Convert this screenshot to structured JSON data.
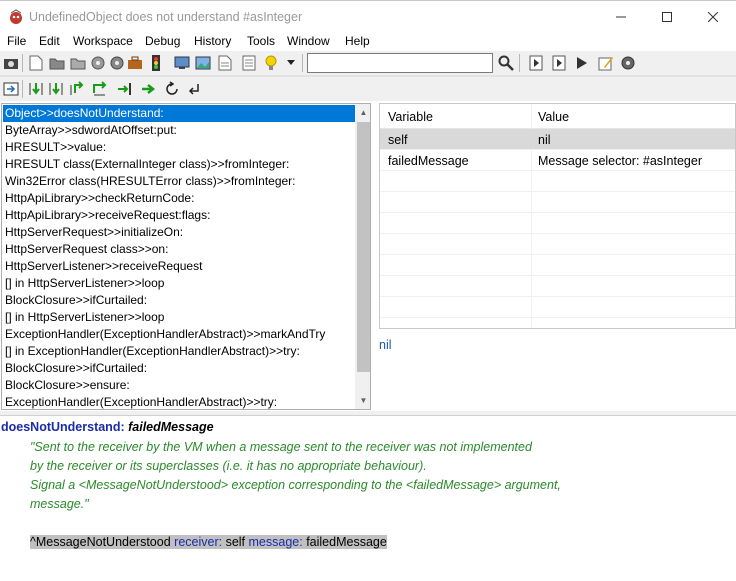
{
  "window": {
    "title": "UndefinedObject does not understand #asInteger",
    "minimize_icon": "minimize-icon",
    "maximize_icon": "maximize-icon",
    "close_icon": "close-icon"
  },
  "menu": {
    "items": [
      "File",
      "Edit",
      "Workspace",
      "Debug",
      "History",
      "Tools",
      "Window",
      "Help"
    ]
  },
  "toolbar": {
    "search": {
      "value": "",
      "placeholder": ""
    },
    "icons_row1": [
      "camera-icon",
      "new-document-icon",
      "open-folder-icon",
      "open-folder-2-icon",
      "gear-icon",
      "gear-settings-icon",
      "briefcase-icon",
      "traffic-light-icon",
      "display-icon",
      "picture-icon",
      "document-icon",
      "notes-icon",
      "lightbulb-icon",
      "dropdown-arrow-icon",
      "search-magnifier-icon",
      "step-icon",
      "step-into-icon",
      "run-icon",
      "edit-icon",
      "settings-gear-icon"
    ],
    "icons_row2": [
      "return-icon",
      "step-into-bracket-icon",
      "step-over-bracket-icon",
      "step-out-bracket-icon",
      "step-over-icon",
      "run-to-cursor-icon",
      "go-icon",
      "restart-icon",
      "return-back-icon"
    ]
  },
  "stack": {
    "frames": [
      "Object>>doesNotUnderstand:",
      "ByteArray>>sdwordAtOffset:put:",
      "HRESULT>>value:",
      "HRESULT class(ExternalInteger class)>>fromInteger:",
      "Win32Error class(HRESULTError class)>>fromInteger:",
      "HttpApiLibrary>>checkReturnCode:",
      "HttpApiLibrary>>receiveRequest:flags:",
      "HttpServerRequest>>initializeOn:",
      "HttpServerRequest class>>on:",
      "HttpServerListener>>receiveRequest",
      "[] in HttpServerListener>>loop",
      "BlockClosure>>ifCurtailed:",
      "[] in HttpServerListener>>loop",
      "ExceptionHandler(ExceptionHandlerAbstract)>>markAndTry",
      "[] in ExceptionHandler(ExceptionHandlerAbstract)>>try:",
      "BlockClosure>>ifCurtailed:",
      "BlockClosure>>ensure:",
      "ExceptionHandler(ExceptionHandlerAbstract)>>try:"
    ],
    "selected_index": 0
  },
  "variables": {
    "headers": {
      "variable": "Variable",
      "value": "Value"
    },
    "rows": [
      {
        "name": "self",
        "value": "nil"
      },
      {
        "name": "failedMessage",
        "value": "Message selector: #asInteger"
      }
    ],
    "selected_value_display": "nil"
  },
  "source": {
    "selector": "doesNotUnderstand:",
    "argument": "failedMessage",
    "comment_lines": [
      "\"Sent to the receiver by the VM when a message sent to the receiver was not implemented",
      "by the receiver or its superclasses (i.e. it has no appropriate behaviour).",
      "Signal a <MessageNotUnderstood> exception corresponding to the <failedMessage> argument,",
      "message.\""
    ],
    "code": {
      "caret_class": "^MessageNotUnderstood",
      "kw1": "receiver:",
      "arg1": "self",
      "kw2": "message:",
      "arg2": "failedMessage"
    }
  }
}
